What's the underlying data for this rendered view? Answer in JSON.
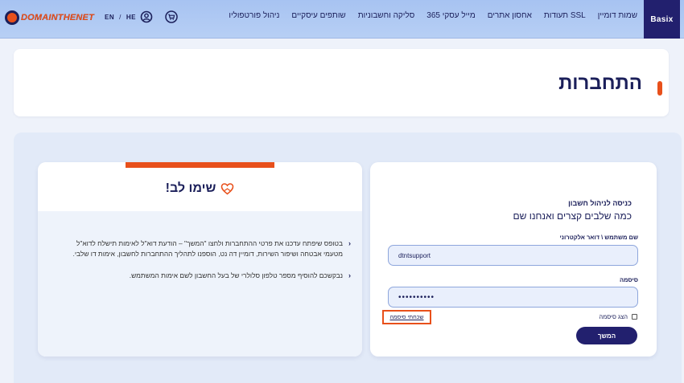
{
  "header": {
    "brand_name": "DOMAINTHENET",
    "lang_he": "HE",
    "lang_sep": "/",
    "lang_en": "EN",
    "basix_label": "Basix",
    "menu": [
      "שמות דומיין",
      "תעודות SSL",
      "אחסון אתרים",
      "מייל עסקי 365",
      "סליקה וחשבוניות",
      "שותפים עיסקיים",
      "ניהול פורטפוליו"
    ],
    "icons": [
      "user-icon",
      "cart-icon"
    ]
  },
  "page": {
    "title": "התחברות"
  },
  "notice": {
    "heading": "שימו לב!",
    "icon": "heart-hands-icon",
    "items": [
      "בטופס שיפתח עדכנו את פרטי ההתחברות ולחצו \"המשך\" – הודעת דוא\"ל לאימות תישלח לדוא\"ל מטעמי אבטחה ושיפור השירות, דומיין דה נט, הוספנו לתהליך ההתחברות לחשבון, אימות דו שלבי.",
      "נבקשכם להוסיף מספר טלפון סלולרי של בעל החשבון לשם אימות המשתמש."
    ]
  },
  "login": {
    "title": "כניסה לניהול חשבון",
    "subtitle": "כמה שלבים קצרים ואנחנו שם",
    "username_label": "שם משתמש \\ דואר אלקטרוני",
    "username_value": "dtntsupport",
    "password_label": "סיסמה",
    "password_value": "••••••••••",
    "show_password_label": "הצג סיסמה",
    "forgot_password_label": "שכחתי סיסמה",
    "continue_label": "המשך"
  },
  "colors": {
    "accent": "#e8501b",
    "navy": "#22206e",
    "text": "#1b1f5a",
    "nav_bg": "#a7c3f2"
  }
}
